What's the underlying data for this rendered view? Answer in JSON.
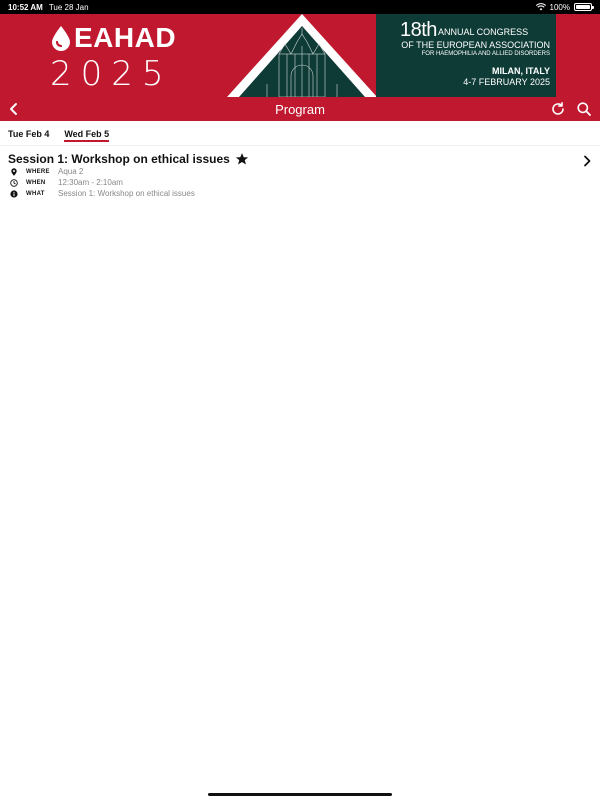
{
  "status_bar": {
    "time": "10:52 AM",
    "date": "Tue 28 Jan",
    "battery": "100%",
    "battery_level": 1.0
  },
  "banner": {
    "logo_name": "EAHAD",
    "logo_year": "2025",
    "congress_number": "18th",
    "congress_line1": "ANNUAL CONGRESS",
    "congress_line2": "OF THE EUROPEAN ASSOCIATION",
    "congress_line3": "FOR HAEMOPHILIA AND ALLIED DISORDERS",
    "city": "MILAN, ITALY",
    "dates": "4-7 FEBRUARY 2025"
  },
  "nav": {
    "title": "Program"
  },
  "tabs": [
    {
      "label": "Tue Feb 4"
    },
    {
      "label": "Wed Feb 5"
    }
  ],
  "session": {
    "title": "Session 1: Workshop on ethical issues",
    "where_label": "WHERE",
    "where_value": "Aqua 2",
    "when_label": "WHEN",
    "when_value": "12:30am - 2:10am",
    "what_label": "WHAT",
    "what_value": "Session 1: Workshop on ethical issues"
  },
  "colors": {
    "brand_red": "#c0182f",
    "banner_green": "#0f3b37"
  }
}
